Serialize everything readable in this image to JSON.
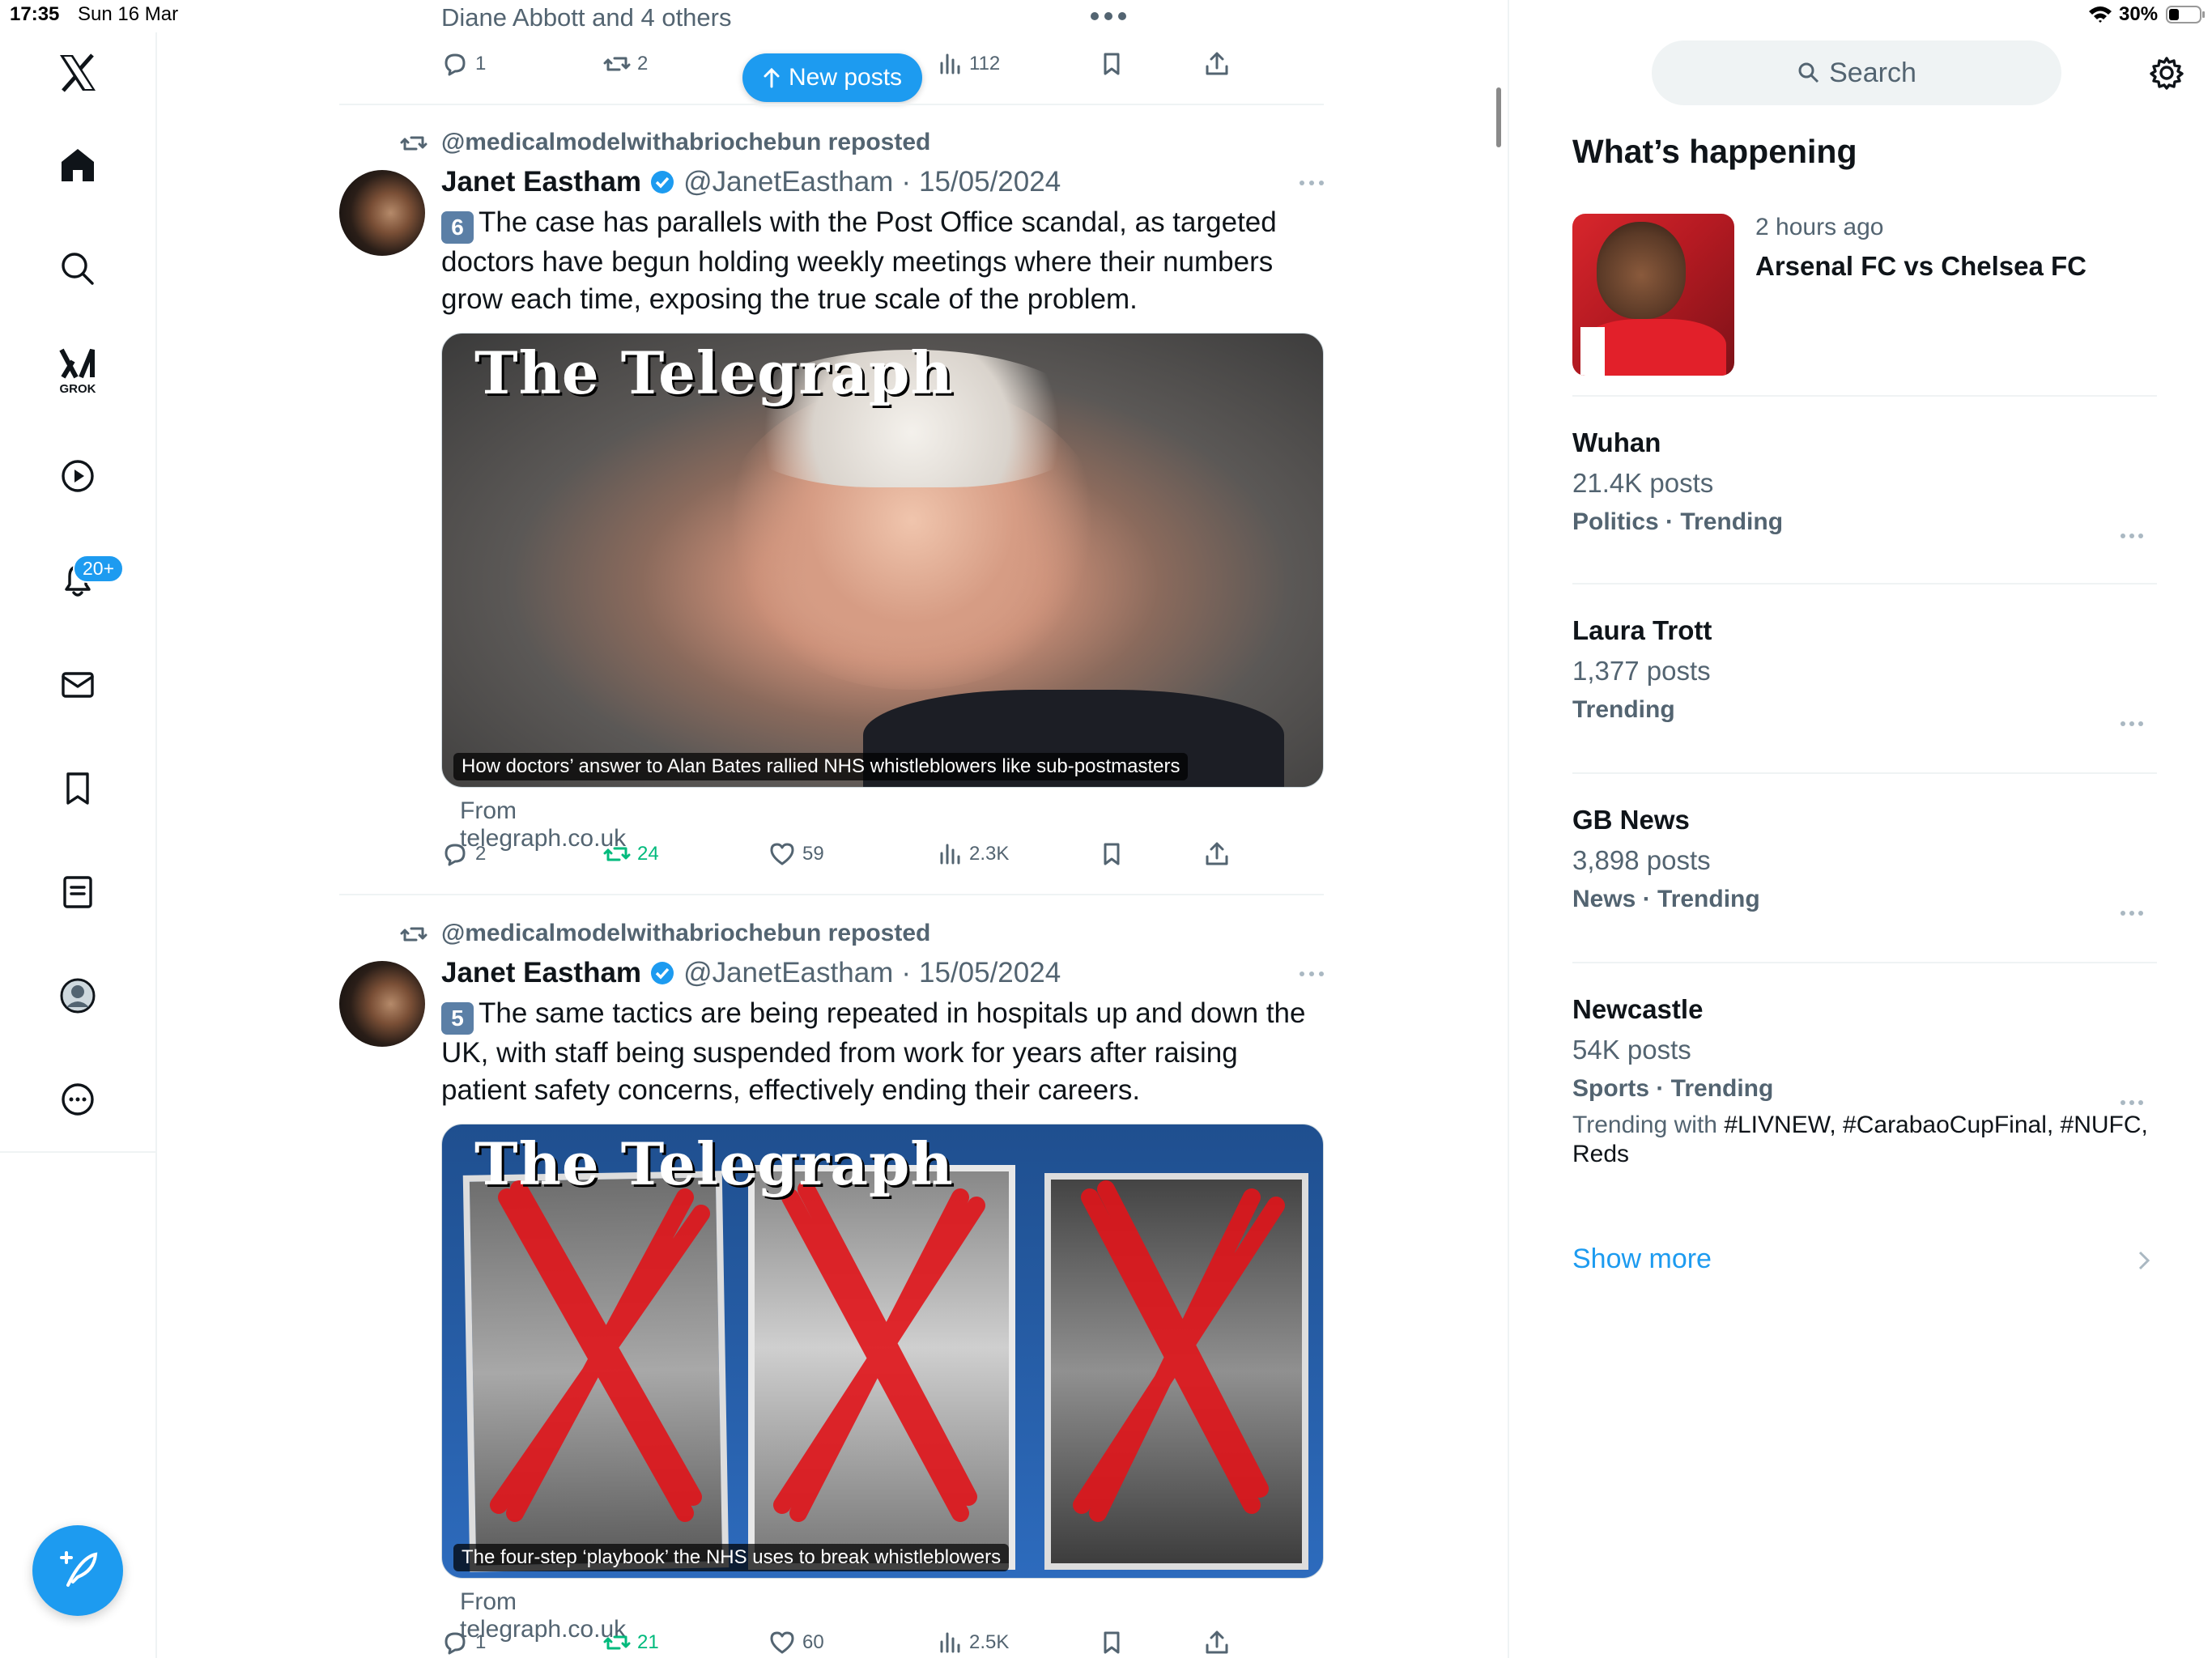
{
  "status_bar": {
    "time": "17:35",
    "date": "Sun 16 Mar",
    "battery": "30%"
  },
  "nav": {
    "notifications_badge": "20+",
    "grok_label": "GROK"
  },
  "top_tweet": {
    "liked_by": "Diane Abbott and 4 others",
    "replies": "1",
    "reposts": "2",
    "views": "112"
  },
  "new_posts_label": "New posts",
  "tweets": [
    {
      "repost_label": "@medicalmodelwithabriochebun reposted",
      "author": "Janet Eastham",
      "handle": "@JanetEastham",
      "date": "15/05/2024",
      "keycap": "6",
      "text": "The case has parallels with the Post Office scandal, as targeted doctors have begun holding weekly meetings where their numbers grow each time, exposing the true scale of the problem.",
      "card_logo": "The Telegraph",
      "card_caption": "How doctors’ answer to Alan Bates rallied NHS whistleblowers like sub-postmasters",
      "card_source": "From telegraph.co.uk",
      "replies": "2",
      "reposts": "24",
      "likes": "59",
      "views": "2.3K"
    },
    {
      "repost_label": "@medicalmodelwithabriochebun reposted",
      "author": "Janet Eastham",
      "handle": "@JanetEastham",
      "date": "15/05/2024",
      "keycap": "5",
      "text": "The same tactics are being repeated in hospitals up and down the UK, with staff being suspended from work for years after raising patient safety concerns, effectively ending their careers.",
      "card_logo": "The Telegraph",
      "card_caption": "The four-step ‘playbook’ the NHS uses to break whistleblowers",
      "card_source": "From telegraph.co.uk",
      "replies": "1",
      "reposts": "21",
      "likes": "60",
      "views": "2.5K"
    }
  ],
  "sidebar": {
    "search_placeholder": "Search",
    "heading": "What’s happening",
    "featured": {
      "time": "2 hours ago",
      "title": "Arsenal FC vs Chelsea FC"
    },
    "trends": [
      {
        "name": "Wuhan",
        "count": "21.4K posts",
        "meta": "Politics · Trending"
      },
      {
        "name": "Laura Trott",
        "count": "1,377 posts",
        "meta": "Trending"
      },
      {
        "name": "GB News",
        "count": "3,898 posts",
        "meta": "News · Trending"
      },
      {
        "name": "Newcastle",
        "count": "54K posts",
        "meta": "Sports · Trending",
        "extra_prefix": "Trending with ",
        "extra_tags": "#LIVNEW, #CarabaoCupFinal, #NUFC, Reds"
      }
    ],
    "show_more": "Show more"
  },
  "colors": {
    "accent": "#1d9bf0",
    "repost_green": "#00ba7c",
    "text": "#0f1419",
    "muted": "#536471"
  }
}
